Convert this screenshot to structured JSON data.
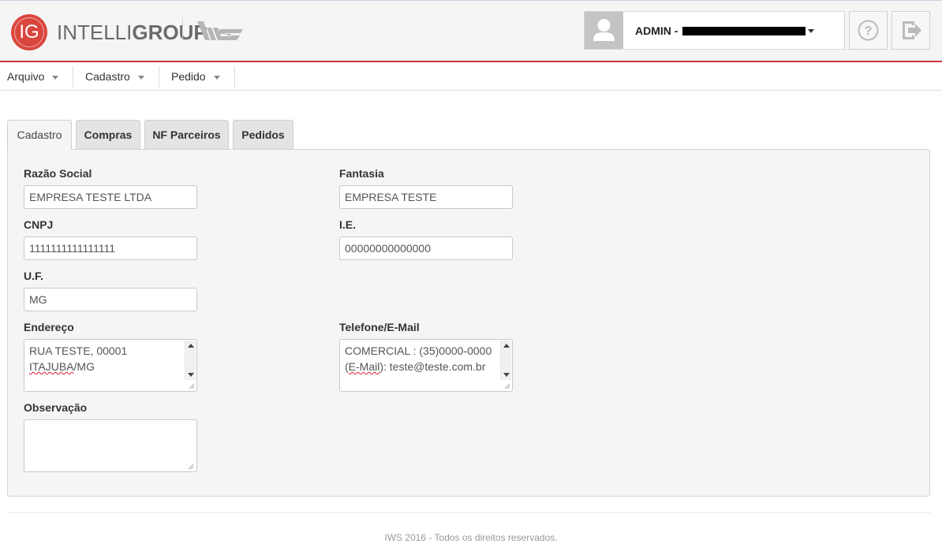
{
  "header": {
    "logo_text": "IG",
    "brand_light": "INTELLI",
    "brand_bold": "GROUP",
    "iws_logo": "iws-logo-icon",
    "user_label": "ADMIN -",
    "help_icon": "help-circle-icon",
    "exit_icon": "logout-icon"
  },
  "menu": {
    "items": [
      {
        "label": "Arquivo"
      },
      {
        "label": "Cadastro"
      },
      {
        "label": "Pedido"
      }
    ]
  },
  "tabs": [
    {
      "label": "Cadastro",
      "active": true
    },
    {
      "label": "Compras",
      "active": false
    },
    {
      "label": "NF Parceiros",
      "active": false
    },
    {
      "label": "Pedidos",
      "active": false
    }
  ],
  "form": {
    "razao_social": {
      "label": "Razão Social",
      "value": "EMPRESA TESTE LTDA"
    },
    "fantasia": {
      "label": "Fantasia",
      "value": "EMPRESA TESTE"
    },
    "cnpj": {
      "label": "CNPJ",
      "value": "1111111111111111"
    },
    "ie": {
      "label": "I.E.",
      "value": "00000000000000"
    },
    "uf": {
      "label": "U.F.",
      "value": "MG"
    },
    "endereco": {
      "label": "Endereço",
      "line1": "RUA TESTE, 00001",
      "line2_prefix": "ITAJUBA",
      "line2_suffix": "/MG"
    },
    "telefone": {
      "label": "Telefone/E-Mail",
      "line1": "COMERCIAL : (35)0000-0000",
      "line2_prefix": "(",
      "line2_word": "E-Mail",
      "line2_suffix": "): teste@teste.com.br"
    },
    "observacao": {
      "label": "Observação",
      "value": ""
    }
  },
  "footer": {
    "text": "IWS 2016 - Todos os direitos reservados."
  },
  "colors": {
    "accent_red": "#c8383c",
    "logo_red": "#d9463e"
  }
}
